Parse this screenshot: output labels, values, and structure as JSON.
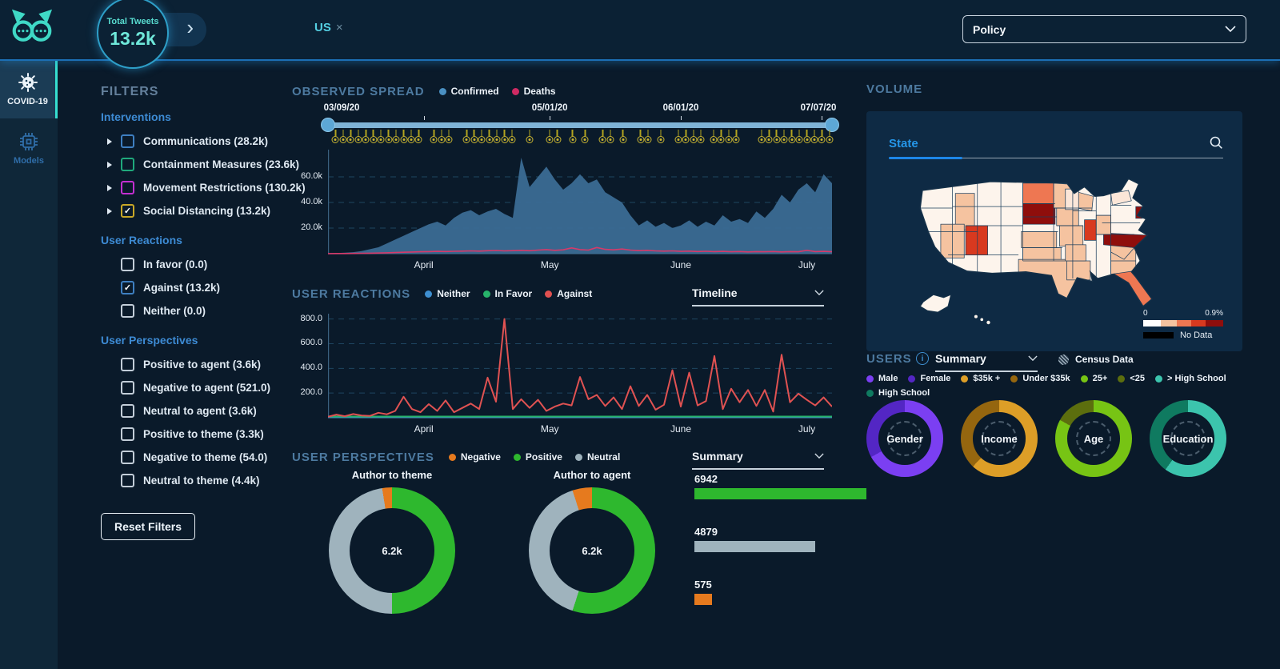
{
  "app": {
    "policy_dropdown_label": "Policy"
  },
  "glyphs": {
    "chevron_right": "›",
    "close": "×",
    "check": "✓",
    "info": "i"
  },
  "topbar": {
    "total_tweets_label": "Total Tweets",
    "total_tweets_value": "13.2k",
    "selected_filter": "US"
  },
  "sidebar": {
    "items": [
      {
        "id": "covid19",
        "label": "COVID-19",
        "active": true
      },
      {
        "id": "models",
        "label": "Models",
        "active": false
      }
    ]
  },
  "filters": {
    "title": "FILTERS",
    "reset_button": "Reset Filters",
    "groups": [
      {
        "label": "Interventions",
        "items": [
          {
            "label": "Communications (28.2k)",
            "color": "#3e7fc1",
            "checked": false,
            "expandable": true
          },
          {
            "label": "Containment Measures (23.6k)",
            "color": "#1fa97c",
            "checked": false,
            "expandable": true
          },
          {
            "label": "Movement Restrictions (130.2k)",
            "color": "#c32fd1",
            "checked": false,
            "expandable": true
          },
          {
            "label": "Social Distancing (13.2k)",
            "color": "#c8a727",
            "checked": true,
            "expandable": true
          }
        ]
      },
      {
        "label": "User Reactions",
        "items": [
          {
            "label": "In favor (0.0)",
            "color": "#c2cdd8",
            "checked": false,
            "expandable": false
          },
          {
            "label": "Against (13.2k)",
            "color": "#3e7fc1",
            "checked": true,
            "expandable": false
          },
          {
            "label": "Neither (0.0)",
            "color": "#c2cdd8",
            "checked": false,
            "expandable": false
          }
        ]
      },
      {
        "label": "User Perspectives",
        "items": [
          {
            "label": "Positive to agent (3.6k)",
            "color": "#c2cdd8",
            "checked": false,
            "expandable": false
          },
          {
            "label": "Negative to agent (521.0)",
            "color": "#c2cdd8",
            "checked": false,
            "expandable": false
          },
          {
            "label": "Neutral to agent (3.6k)",
            "color": "#c2cdd8",
            "checked": false,
            "expandable": false
          },
          {
            "label": "Positive to theme (3.3k)",
            "color": "#c2cdd8",
            "checked": false,
            "expandable": false
          },
          {
            "label": "Negative to theme (54.0)",
            "color": "#c2cdd8",
            "checked": false,
            "expandable": false
          },
          {
            "label": "Neutral to theme (4.4k)",
            "color": "#c2cdd8",
            "checked": false,
            "expandable": false
          }
        ]
      }
    ]
  },
  "observed_spread": {
    "title": "OBSERVED SPREAD",
    "legend": [
      {
        "label": "Confirmed",
        "color": "#4a90c2"
      },
      {
        "label": "Deaths",
        "color": "#cf2a63"
      }
    ],
    "timeline": {
      "dates": [
        "03/09/20",
        "05/01/20",
        "06/01/20",
        "07/07/20"
      ],
      "date_positions": [
        0,
        44,
        70,
        100
      ],
      "tick_positions": [
        19,
        44,
        70,
        98
      ],
      "event_positions": [
        1.5,
        3,
        4.5,
        6,
        7.5,
        9,
        10.5,
        12,
        13.5,
        15,
        16.5,
        18,
        21,
        22.5,
        24,
        27.5,
        29,
        30.5,
        32,
        33.5,
        35,
        36.5,
        40,
        44,
        45.5,
        48.5,
        51,
        54.5,
        56,
        58.5,
        62,
        63.5,
        66,
        69.5,
        71,
        72.5,
        74,
        76.5,
        78,
        79.5,
        81,
        86,
        87.5,
        89,
        90.5,
        92,
        93.5,
        95,
        96.5,
        98,
        99.5
      ]
    }
  },
  "user_reactions": {
    "title": "USER REACTIONS",
    "dropdown": "Timeline",
    "legend": [
      {
        "label": "Neither",
        "color": "#3e8fd0"
      },
      {
        "label": "In Favor",
        "color": "#27b36a"
      },
      {
        "label": "Against",
        "color": "#e05050"
      }
    ]
  },
  "user_perspectives": {
    "title": "USER PERSPECTIVES",
    "dropdown": "Summary",
    "legend": [
      {
        "label": "Negative",
        "color": "#e67a1e"
      },
      {
        "label": "Positive",
        "color": "#2eb82e"
      },
      {
        "label": "Neutral",
        "color": "#9fb3bd"
      }
    ]
  },
  "volume": {
    "title": "VOLUME",
    "search_label": "State",
    "map_legend": {
      "min": "0",
      "max": "0.9%",
      "no_data": "No Data"
    }
  },
  "users": {
    "title": "USERS",
    "dropdown": "Summary",
    "census_label": "Census Data",
    "legend": [
      {
        "label": "Male",
        "color": "#7b3ff2"
      },
      {
        "label": "Female",
        "color": "#5326c4"
      },
      {
        "label": "$35k +",
        "color": "#dd9e27"
      },
      {
        "label": "Under $35k",
        "color": "#95660f"
      },
      {
        "label": "25+",
        "color": "#77c414"
      },
      {
        "label": "<25",
        "color": "#5c6e0e"
      },
      {
        "label": "> High School",
        "color": "#3cc4ad"
      },
      {
        "label": "High School",
        "color": "#0f7a60"
      }
    ]
  },
  "chart_data": [
    {
      "id": "observed_spread",
      "type": "area",
      "title": "OBSERVED SPREAD",
      "months": [
        "April",
        "May",
        "June",
        "July"
      ],
      "month_positions": [
        19,
        44,
        70,
        95
      ],
      "ymax": 80,
      "ylim": [
        0,
        80000
      ],
      "yticks": [
        {
          "v": 20,
          "label": "20.0k"
        },
        {
          "v": 40,
          "label": "40.0k"
        },
        {
          "v": 60,
          "label": "60.0k"
        }
      ],
      "x_note": "values in thousands, evenly spaced 03/09/20 - 07/07/20",
      "series": [
        {
          "name": "Confirmed",
          "kind": "area",
          "color": "#3b6c94",
          "values": [
            0.3,
            0.5,
            0.8,
            1.2,
            2,
            3.5,
            5,
            8,
            11,
            14,
            17,
            20,
            23,
            25,
            22,
            28,
            32,
            34,
            30,
            33,
            35,
            31,
            28,
            75,
            52,
            60,
            68,
            58,
            50,
            55,
            62,
            55,
            58,
            48,
            44,
            40,
            30,
            22,
            26,
            21,
            24,
            20,
            22,
            26,
            21,
            25,
            22,
            30,
            25,
            27,
            24,
            33,
            28,
            35,
            46,
            40,
            50,
            55,
            48,
            62,
            55
          ]
        },
        {
          "name": "Deaths",
          "kind": "line",
          "color": "#d63a6a",
          "width": 1.6,
          "values": [
            0.05,
            0.1,
            0.15,
            0.2,
            0.3,
            0.4,
            0.5,
            0.7,
            0.9,
            1.1,
            1.3,
            1.5,
            1.6,
            1.8,
            1.7,
            1.9,
            2,
            2.2,
            2,
            2.3,
            2.5,
            2.2,
            2.4,
            2.6,
            2.3,
            2.8,
            3.2,
            2.6,
            3,
            4.5,
            3.2,
            2.8,
            4.8,
            3.4,
            3,
            3.6,
            2.8,
            2.4,
            2.6,
            2.2,
            2,
            2.2,
            1.8,
            2,
            1.7,
            1.9,
            1.6,
            1.8,
            1.5,
            1.7,
            1.4,
            1.6,
            1.5,
            1.7,
            1.4,
            1.6,
            1.5,
            2.6,
            1.6,
            1.8,
            1.5
          ]
        }
      ]
    },
    {
      "id": "user_reactions",
      "type": "line",
      "title": "USER REACTIONS",
      "months": [
        "April",
        "May",
        "June",
        "July"
      ],
      "month_positions": [
        19,
        44,
        70,
        95
      ],
      "ymax": 830,
      "ylim": [
        0,
        830
      ],
      "yticks": [
        {
          "v": 200,
          "label": "200.0"
        },
        {
          "v": 400,
          "label": "400.0"
        },
        {
          "v": 600,
          "label": "600.0"
        },
        {
          "v": 800,
          "label": "800.0"
        }
      ],
      "series": [
        {
          "name": "Neither",
          "kind": "line",
          "color": "#3e8fd0",
          "width": 1.6,
          "flat": 4
        },
        {
          "name": "In Favor",
          "kind": "line",
          "color": "#27b36a",
          "width": 2,
          "flat": 10
        },
        {
          "name": "Against",
          "kind": "line",
          "color": "#e05252",
          "width": 2,
          "values": [
            8,
            25,
            12,
            30,
            18,
            15,
            40,
            28,
            55,
            170,
            70,
            45,
            110,
            55,
            140,
            45,
            80,
            115,
            70,
            325,
            130,
            800,
            70,
            150,
            80,
            145,
            55,
            90,
            115,
            100,
            330,
            150,
            185,
            95,
            165,
            70,
            255,
            95,
            185,
            65,
            105,
            385,
            90,
            365,
            100,
            135,
            500,
            70,
            235,
            125,
            225,
            95,
            225,
            50,
            510,
            125,
            195,
            145,
            100,
            165,
            90
          ]
        }
      ]
    },
    {
      "id": "perspective_donuts",
      "type": "pie",
      "donuts": [
        {
          "title": "Author to theme",
          "center": "6.2k",
          "from": -9,
          "segments": [
            {
              "label": "Negative",
              "pct": 2.5,
              "color": "#e67a1e"
            },
            {
              "label": "Positive",
              "pct": 50,
              "color": "#2eb82e"
            },
            {
              "label": "Neutral",
              "pct": 47.5,
              "color": "#9fb3bd"
            }
          ]
        },
        {
          "title": "Author to agent",
          "center": "6.2k",
          "from": -18,
          "segments": [
            {
              "label": "Negative",
              "pct": 5,
              "color": "#e67a1e"
            },
            {
              "label": "Positive",
              "pct": 55,
              "color": "#2eb82e"
            },
            {
              "label": "Neutral",
              "pct": 40,
              "color": "#9fb3bd"
            }
          ]
        }
      ]
    },
    {
      "id": "perspective_summary",
      "type": "bar",
      "bars": [
        {
          "label": "6942",
          "value": 6942,
          "pct": 100,
          "color": "#2eb82e"
        },
        {
          "label": "4879",
          "value": 4879,
          "pct": 70,
          "color": "#9fb3bd"
        },
        {
          "label": "575",
          "value": 575,
          "pct": 10,
          "color": "#e67a1e"
        }
      ]
    },
    {
      "id": "user_donuts",
      "type": "pie",
      "donuts": [
        {
          "title": "Gender",
          "from": 0,
          "segments": [
            {
              "label": "Male",
              "pct": 67,
              "color": "#7b3ff2"
            },
            {
              "label": "Female",
              "pct": 33,
              "color": "#5326c4"
            }
          ]
        },
        {
          "title": "Income",
          "from": 0,
          "segments": [
            {
              "label": "$35k +",
              "pct": 62,
              "color": "#dd9e27"
            },
            {
              "label": "Under $35k",
              "pct": 38,
              "color": "#95660f"
            }
          ]
        },
        {
          "title": "Age",
          "from": 0,
          "segments": [
            {
              "label": "25+",
              "pct": 83,
              "color": "#77c414"
            },
            {
              "label": "<25",
              "pct": 17,
              "color": "#5c6e0e"
            }
          ]
        },
        {
          "title": "Education",
          "from": 0,
          "segments": [
            {
              "label": "> High School",
              "pct": 60,
              "color": "#3cc4ad"
            },
            {
              "label": "High School",
              "pct": 40,
              "color": "#0f7a60"
            }
          ]
        }
      ]
    },
    {
      "id": "state_map",
      "type": "heatmap",
      "legend_min": "0",
      "legend_max": "0.9%",
      "no_data_label": "No Data",
      "palette": [
        "#fdf4ec",
        "#fbe6d8",
        "#f5c3a0",
        "#ee7752",
        "#d8391f",
        "#8f0e0c"
      ],
      "state_levels": {
        "AK": 0,
        "HI": 0,
        "ID": 2,
        "NV": 2,
        "UT": 4,
        "ND": 3,
        "SD": 5,
        "MN": 2,
        "IA": 2,
        "MO": 2,
        "KS": 2,
        "OK": 2,
        "TX": 2,
        "LA": 2,
        "AR": 2,
        "GA": 2,
        "SC": 2,
        "NC": 5,
        "FL": 3,
        "IN": 4,
        "OH": 2,
        "MI": 2,
        "WI": 1,
        "NY": 1,
        "NJ": 5
      }
    }
  ]
}
